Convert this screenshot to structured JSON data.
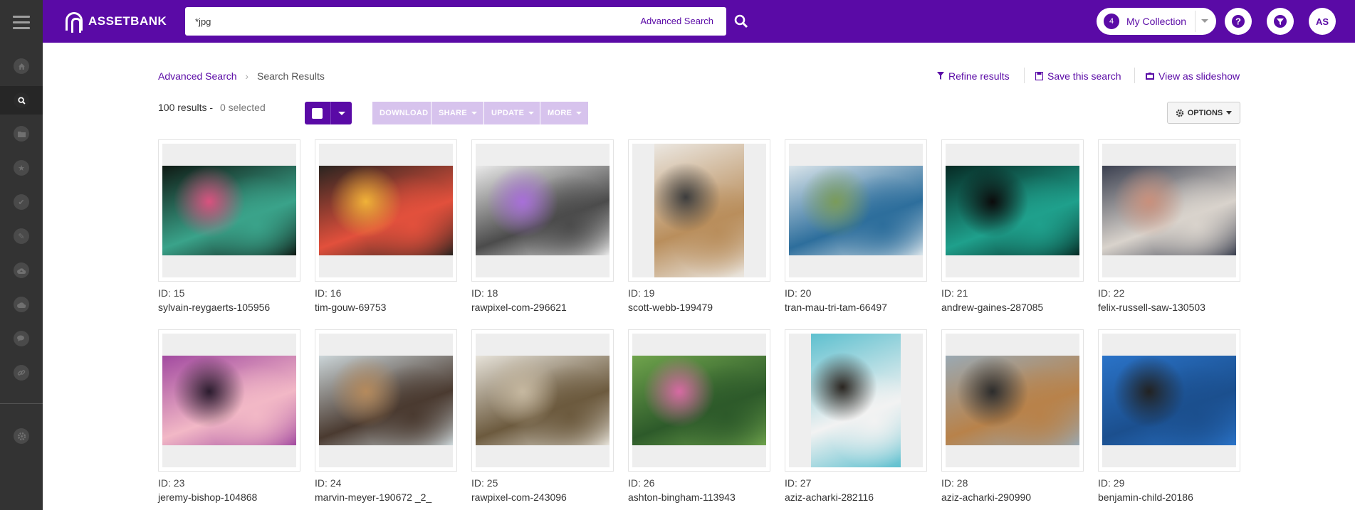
{
  "app": {
    "logo_text": "ASSETBANK"
  },
  "search": {
    "value": "*jpg",
    "placeholder": "",
    "advanced_label": "Advanced Search"
  },
  "header": {
    "collection_count": "4",
    "collection_label": "My Collection",
    "user_initials": "AS",
    "accent": "#5a0aa6"
  },
  "breadcrumb": {
    "link": "Advanced Search",
    "current": "Search Results"
  },
  "actions": {
    "refine": "Refine results",
    "save": "Save this search",
    "slideshow": "View as slideshow"
  },
  "summary": {
    "results": "100 results -",
    "selected": "0 selected"
  },
  "bulk": {
    "download": "DOWNLOAD",
    "share": "SHARE",
    "update": "UPDATE",
    "more": "MORE"
  },
  "options_label": "OPTIONS",
  "sidebar_icons": [
    "home-icon",
    "search-icon",
    "folder-icon",
    "star-icon",
    "check-icon",
    "pencil-icon",
    "upload-cloud-icon",
    "cloud-icon",
    "comments-icon",
    "link-icon",
    "settings-icon"
  ],
  "assets": [
    {
      "id": "ID: 15",
      "name": "sylvain-reygaerts-105956",
      "orientation": "landscape",
      "colors": [
        "#0f1a14",
        "#3aa38a",
        "#d9527f"
      ]
    },
    {
      "id": "ID: 16",
      "name": "tim-gouw-69753",
      "orientation": "landscape",
      "colors": [
        "#2a2420",
        "#e2503c",
        "#f0b238"
      ]
    },
    {
      "id": "ID: 18",
      "name": "rawpixel-com-296621",
      "orientation": "landscape",
      "colors": [
        "#e9e9e9",
        "#4b4b4b",
        "#a86fd9"
      ]
    },
    {
      "id": "ID: 19",
      "name": "scott-webb-199479",
      "orientation": "portrait",
      "colors": [
        "#ebe7e1",
        "#b98e5c",
        "#3d3d3d"
      ]
    },
    {
      "id": "ID: 20",
      "name": "tran-mau-tri-tam-66497",
      "orientation": "landscape",
      "colors": [
        "#d9e4ea",
        "#2d6e9c",
        "#7a9b5a"
      ]
    },
    {
      "id": "ID: 21",
      "name": "andrew-gaines-287085",
      "orientation": "landscape",
      "colors": [
        "#062a24",
        "#1fa08c",
        "#0b0b0b"
      ]
    },
    {
      "id": "ID: 22",
      "name": "felix-russell-saw-130503",
      "orientation": "landscape",
      "colors": [
        "#3b4050",
        "#d9d3cc",
        "#c9907c"
      ]
    },
    {
      "id": "ID: 23",
      "name": "jeremy-bishop-104868",
      "orientation": "landscape",
      "colors": [
        "#a24aa0",
        "#f2b8c6",
        "#2b1c2e"
      ]
    },
    {
      "id": "ID: 24",
      "name": "marvin-meyer-190672 _2_",
      "orientation": "landscape",
      "colors": [
        "#cbd5d8",
        "#4a3a30",
        "#b58a5c"
      ]
    },
    {
      "id": "ID: 25",
      "name": "rawpixel-com-243096",
      "orientation": "landscape",
      "colors": [
        "#e6e2d9",
        "#6c5a3e",
        "#c6b8a0"
      ]
    },
    {
      "id": "ID: 26",
      "name": "ashton-bingham-113943",
      "orientation": "landscape",
      "colors": [
        "#6fa34c",
        "#2d5a2a",
        "#d76aa3"
      ]
    },
    {
      "id": "ID: 27",
      "name": "aziz-acharki-282116",
      "orientation": "portrait",
      "colors": [
        "#5ec0cf",
        "#f2f2f2",
        "#2a2520"
      ]
    },
    {
      "id": "ID: 28",
      "name": "aziz-acharki-290990",
      "orientation": "landscape",
      "colors": [
        "#9aa9b3",
        "#b8824a",
        "#2c2c2c"
      ]
    },
    {
      "id": "ID: 29",
      "name": "benjamin-child-20186",
      "orientation": "landscape",
      "colors": [
        "#2a73c8",
        "#1b4f8e",
        "#222"
      ]
    }
  ]
}
